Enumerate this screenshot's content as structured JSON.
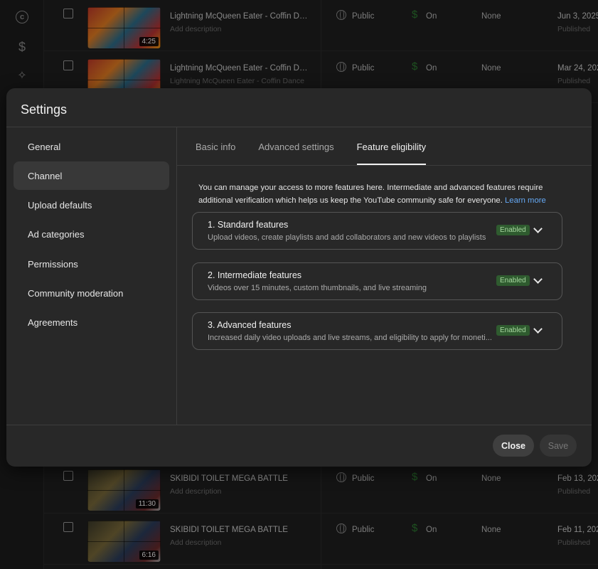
{
  "background": {
    "rail_icons": [
      "copyright-icon",
      "dollar-icon",
      "magic-wand-icon"
    ],
    "videos": [
      {
        "title": "Lightning McQueen Eater - Coffin Dan...",
        "desc": "Add description",
        "duration": "4:25",
        "visibility": "Public",
        "monetization": "On",
        "restrictions": "None",
        "date": "Jun 3, 2025",
        "status": "Published",
        "thumb": "cars"
      },
      {
        "title": "Lightning McQueen Eater - Coffin Dan...",
        "desc": "Lightning McQueen Eater - Coffin Dance",
        "duration": "",
        "visibility": "Public",
        "monetization": "On",
        "restrictions": "None",
        "date": "Mar 24, 202",
        "status": "Published",
        "thumb": "cars"
      },
      {
        "title": "SKIBIDI TOILET MEGA BATTLE",
        "desc": "Add description",
        "duration": "11:30",
        "visibility": "Public",
        "monetization": "On",
        "restrictions": "None",
        "date": "Feb 13, 202",
        "status": "Published",
        "thumb": "skibidi"
      },
      {
        "title": "SKIBIDI TOILET MEGA BATTLE",
        "desc": "Add description",
        "duration": "6:16",
        "visibility": "Public",
        "monetization": "On",
        "restrictions": "None",
        "date": "Feb 11, 202",
        "status": "Published",
        "thumb": "skibidi"
      }
    ]
  },
  "modal": {
    "title": "Settings",
    "nav": [
      "General",
      "Channel",
      "Upload defaults",
      "Ad categories",
      "Permissions",
      "Community moderation",
      "Agreements"
    ],
    "nav_active": 1,
    "tabs": [
      "Basic info",
      "Advanced settings",
      "Feature eligibility"
    ],
    "tab_active": 2,
    "intro": "You can manage your access to more features here. Intermediate and advanced features require additional verification which helps us keep the YouTube community safe for everyone.",
    "learn_more": "Learn more",
    "features": [
      {
        "title": "1. Standard features",
        "desc": "Upload videos, create playlists and add collaborators and new videos to playlists",
        "badge": "Enabled"
      },
      {
        "title": "2. Intermediate features",
        "desc": "Videos over 15 minutes, custom thumbnails, and live streaming",
        "badge": "Enabled"
      },
      {
        "title": "3. Advanced features",
        "desc": "Increased daily video uploads and live streams, and eligibility to apply for moneti...",
        "badge": "Enabled"
      }
    ],
    "close_label": "Close",
    "save_label": "Save"
  },
  "colors": {
    "accent_link": "#65a9f5",
    "badge_bg": "#2f5b2f",
    "badge_text": "#a8d8a0",
    "monetization_icon": "#2e7d32"
  }
}
